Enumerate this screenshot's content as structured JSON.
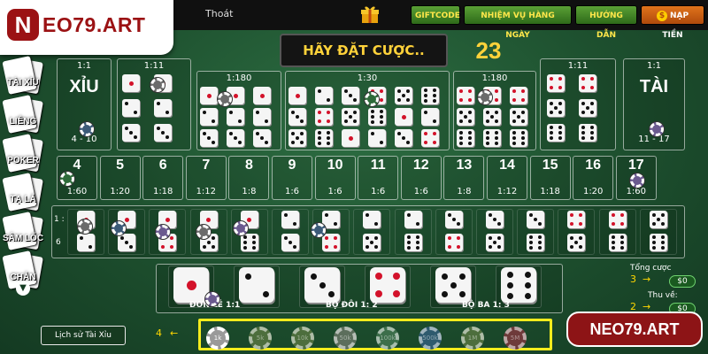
{
  "brand": {
    "logo_mark": "N",
    "logo_text": "EO79.ART",
    "watermark": "NEO79.ART"
  },
  "topbar": {
    "exit": "Thoát",
    "giftcode": "GIFTCODE",
    "missions": "NHIỆM VỤ HÀNG NGÀY",
    "guide": "HƯỚNG DẪN",
    "deposit": "NẠP TIỀN",
    "deposit_icon": "$"
  },
  "sidenav": {
    "items": [
      "TÀI XỈU",
      "LIÊNG",
      "POKER",
      "TẠ LẢ",
      "SÂM LỐC",
      "CHẮN"
    ]
  },
  "status": {
    "banner": "HÃY ĐẶT CƯỢC..",
    "countdown": "23"
  },
  "bets": {
    "small": {
      "word": "XỈU",
      "ratio": "1:1",
      "range": "4 - 10"
    },
    "big": {
      "word": "TÀI",
      "ratio": "1:1",
      "range": "11 - 17"
    },
    "specific_double_ratio": "1:11",
    "specific_triple_ratio": "1:180",
    "any_triple_ratio": "1:30",
    "sums": [
      {
        "num": "4",
        "odds": "1:60"
      },
      {
        "num": "5",
        "odds": "1:20"
      },
      {
        "num": "6",
        "odds": "1:18"
      },
      {
        "num": "7",
        "odds": "1:12"
      },
      {
        "num": "8",
        "odds": "1:8"
      },
      {
        "num": "9",
        "odds": "1:6"
      },
      {
        "num": "10",
        "odds": "1:6"
      },
      {
        "num": "11",
        "odds": "1:6"
      },
      {
        "num": "12",
        "odds": "1:6"
      },
      {
        "num": "13",
        "odds": "1:8"
      },
      {
        "num": "14",
        "odds": "1:12"
      },
      {
        "num": "15",
        "odds": "1:18"
      },
      {
        "num": "16",
        "odds": "1:20"
      },
      {
        "num": "17",
        "odds": "1:60"
      }
    ],
    "combo_side_top": "1 :",
    "combo_side_bottom": "6",
    "singles_label": "ĐƠN LẺ 1:1",
    "doubles_label": "BỘ ĐÔI 1: 2",
    "triples_label": "BỘ BA 1: 3"
  },
  "stats": {
    "total_bet_label": "Tổng cược",
    "total_bet": "$0",
    "win_label": "Thu về:",
    "win": "$0",
    "anno_total": "3",
    "anno_win": "2"
  },
  "bottom": {
    "history": "Lịch sử Tài Xỉu",
    "anno_chips": "4",
    "arrow": "←",
    "chips": [
      "1k",
      "5k",
      "10k",
      "50k",
      "100k",
      "500k",
      "1M",
      "5M"
    ]
  }
}
